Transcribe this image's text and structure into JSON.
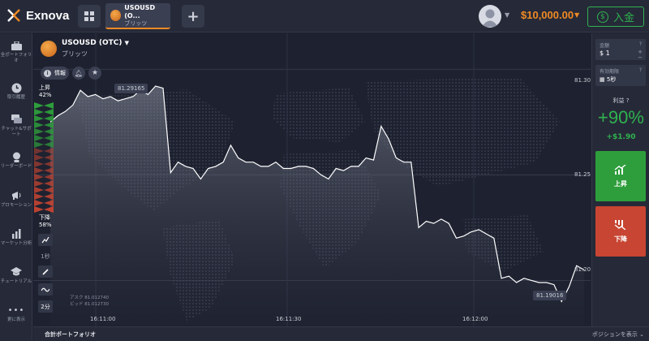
{
  "app": {
    "name": "Exnova"
  },
  "tab": {
    "name": "USOUSD (O...",
    "sub": "ブリッツ"
  },
  "header": {
    "balance": "$10,000.00",
    "deposit_label": "入金"
  },
  "sidebar": {
    "items": [
      {
        "label": "全ポートフォリオ"
      },
      {
        "label": "取引履歴"
      },
      {
        "label": "チャット&サポート"
      },
      {
        "label": "リーダーボード"
      },
      {
        "label": "プロモーション"
      },
      {
        "label": "マーケット分析"
      },
      {
        "label": "チュートリアル"
      },
      {
        "label": "更に表示"
      }
    ]
  },
  "asset": {
    "name": "USOUSD (OTC)",
    "type": "ブリッツ",
    "info_label": "情報"
  },
  "sentiment": {
    "up_label": "上昇",
    "up_pct": "42%",
    "down_label": "下降",
    "down_pct": "58%",
    "up_fraction": 0.42
  },
  "tools": {
    "interval": "1秒",
    "period": "2分"
  },
  "quotes": {
    "ask": "アスク 81.012740",
    "bid": "ビッド 81.012730"
  },
  "chart": {
    "high_tag": "81.29165",
    "low_tag": "81.19016",
    "y_ticks": [
      {
        "label": "81.30",
        "value": 81.3
      },
      {
        "label": "81.25",
        "value": 81.25
      },
      {
        "label": "81.20",
        "value": 81.2
      }
    ],
    "x_ticks": [
      "16:11:00",
      "16:11:30",
      "16:12:00"
    ]
  },
  "chart_data": {
    "type": "area",
    "title": "",
    "xlabel": "",
    "ylabel": "",
    "ylim": [
      81.179,
      81.317
    ],
    "y": [
      81.275,
      81.278,
      81.28,
      81.283,
      81.29,
      81.287,
      81.288,
      81.286,
      81.287,
      81.285,
      81.286,
      81.287,
      81.29,
      81.288,
      81.292,
      81.291,
      81.251,
      81.256,
      81.254,
      81.253,
      81.248,
      81.253,
      81.254,
      81.256,
      81.264,
      81.258,
      81.256,
      81.256,
      81.254,
      81.254,
      81.256,
      81.253,
      81.253,
      81.254,
      81.254,
      81.253,
      81.25,
      81.248,
      81.253,
      81.252,
      81.254,
      81.254,
      81.258,
      81.257,
      81.273,
      81.267,
      81.258,
      81.256,
      81.256,
      81.225,
      81.228,
      81.227,
      81.229,
      81.227,
      81.22,
      81.221,
      81.223,
      81.224,
      81.222,
      81.22,
      81.201,
      81.202,
      81.199,
      81.201,
      81.2,
      81.199,
      81.199,
      81.198,
      81.19,
      81.197,
      81.207,
      81.205
    ]
  },
  "bottom": {
    "portfolio": "合計ポートフォリオ",
    "positions": "ポジションを表示"
  },
  "panel": {
    "amount_label": "金額",
    "amount_currency": "$",
    "amount_value": "1",
    "expiry_label": "有効期限",
    "expiry_value": "5秒",
    "profit_label": "利益",
    "profit_pct": "+90%",
    "profit_amount": "+$1.90",
    "up_label": "上昇",
    "down_label": "下降"
  },
  "colors": {
    "up": "#2e9e3c",
    "down": "#c74532",
    "accent": "#f08a24",
    "line": "#ffffff"
  }
}
